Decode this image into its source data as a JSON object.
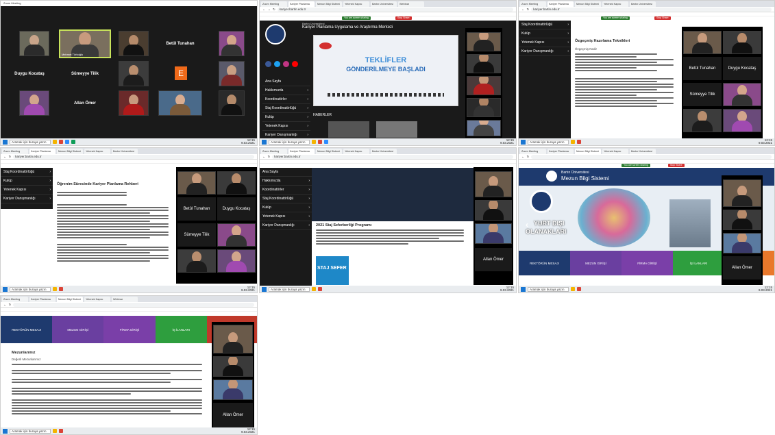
{
  "taskbar": {
    "search_placeholder": "Aramak için buraya yazın",
    "time": "12:15",
    "date": "9.03.2021"
  },
  "panel1": {
    "title": "Zoom Meeting",
    "tiles": [
      {
        "name": "",
        "type": "video"
      },
      {
        "name": "Mehmet Türkoğlu",
        "type": "video"
      },
      {
        "name": "",
        "type": "video"
      },
      {
        "name": "Betül Tunahan",
        "type": "name"
      },
      {
        "name": "",
        "type": "video"
      },
      {
        "name": "Duygu Kocataş",
        "type": "name"
      },
      {
        "name": "Sümeyye Tilik",
        "type": "name"
      },
      {
        "name": "",
        "type": "video"
      },
      {
        "name": "E",
        "type": "avatar"
      },
      {
        "name": "",
        "type": "video"
      },
      {
        "name": "",
        "type": "video"
      },
      {
        "name": "Allan Ömer",
        "type": "name"
      },
      {
        "name": "",
        "type": "video"
      },
      {
        "name": "",
        "type": "video"
      },
      {
        "name": "",
        "type": "video"
      }
    ]
  },
  "panel2": {
    "tabs": [
      "Zoom Meeting",
      "Kariyer Planlama",
      "Mezun Bilgi Sistemi",
      "Yetenek Kapısı",
      "Bartın Üniversitesi",
      "Webinar"
    ],
    "url": "kariyer.bartin.edu.tr",
    "share_label": "You are screen sharing",
    "stop_label": "Stop Share",
    "site_title": "Kariyer Planlama Uygulama ve Araştırma Merkezi",
    "site_org": "Bartın Üniversitesi",
    "banner_line1": "TEKLİFLER",
    "banner_line2": "GÖNDERİLMEYE BAŞLADI",
    "nav_items": [
      "Ana Sayfa",
      "Hakkımızda",
      "Koordinatörler",
      "Staj Koordinatörlüğü",
      "Kulüp",
      "Yetenek Kapısı",
      "Kariyer Danışmanlığı"
    ],
    "news_label": "HABERLER"
  },
  "panel3": {
    "nav_items": [
      "Staj Koordinatörlüğü",
      "Kulüp",
      "Yetenek Kapısı",
      "Kariyer Danışmanlığı"
    ],
    "page_title": "Özgeçmiş Hazırlama Teknikleri",
    "section": "Özgeçmiş Nedir",
    "zoom_names": [
      "Betül Tunahan",
      "Duygu Kocataş",
      "Sümeyye Tilik"
    ]
  },
  "panel4": {
    "nav_items": [
      "Staj Koordinatörlüğü",
      "Kulüp",
      "Yetenek Kapısı",
      "Kariyer Danışmanlığı"
    ],
    "page_title": "Öğrenim Sürecinde Kariyer Planlama Rehberi",
    "zoom_names": [
      "Betül Tunahan",
      "Duygu Kocataş",
      "Sümeyye Tilik"
    ]
  },
  "panel5": {
    "nav_items": [
      "Ana Sayfa",
      "Hakkımızda",
      "Koordinatörler",
      "Staj Koordinatörlüğü",
      "Kulüp",
      "Yetenek Kapısı",
      "Kariyer Danışmanlığı"
    ],
    "article_title": "2021 Staj Seferberliği Programı",
    "promo": "STAJ SEFER",
    "zoom_names": [
      "Allan Ömer"
    ]
  },
  "panel6": {
    "org": "Bartın Üniversitesi",
    "system": "Mezun Bilgi Sistemi",
    "banner_line1": "YURT DIŞI",
    "banner_line2": "OLANAKLARI",
    "menu": [
      "REKTÖRÜN MESAJI",
      "MEZUN GİRİŞİ",
      "FİRMA GİRİŞİ",
      "İŞ İLANLARI"
    ],
    "zoom_names": [
      "Allan Ömer"
    ]
  },
  "panel7": {
    "menu": [
      "REKTÖRÜN MESAJI",
      "MEZUN GİRİŞİ",
      "FİRMA GİRİŞİ",
      "İŞ İLANLARI"
    ],
    "heading": "Mezunlarımız",
    "subheading": "Değerli Mezunlarımız",
    "zoom_names": [
      "Allan Ömer"
    ]
  },
  "colors": {
    "zoom_bg": "#1a1a1a",
    "nav_dark": "#1a1a1a",
    "site_blue": "#1e3a6e",
    "menu_purple": "#6a3fa0",
    "menu_green": "#2e9e3e",
    "menu_orange": "#e9782b",
    "avatar_orange": "#f06a1a"
  }
}
